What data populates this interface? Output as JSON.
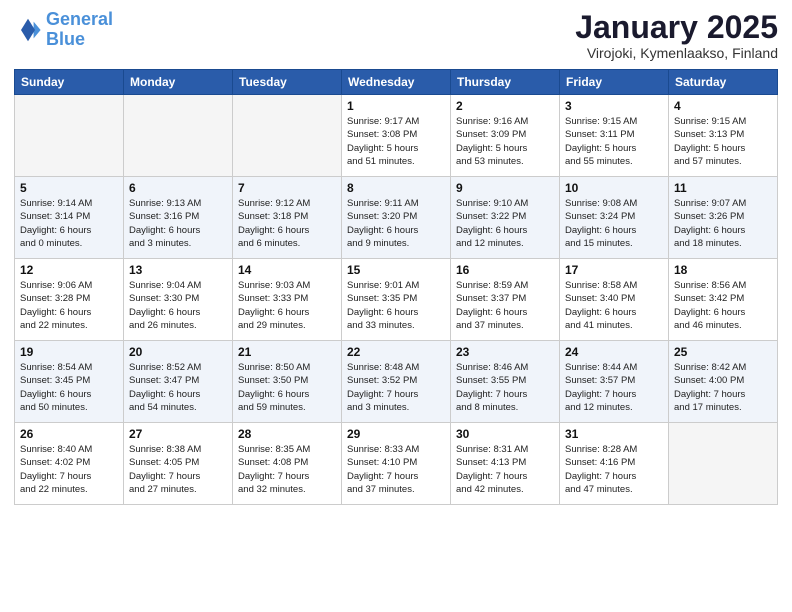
{
  "header": {
    "logo_line1": "General",
    "logo_line2": "Blue",
    "month_title": "January 2025",
    "location": "Virojoki, Kymenlaakso, Finland"
  },
  "weekdays": [
    "Sunday",
    "Monday",
    "Tuesday",
    "Wednesday",
    "Thursday",
    "Friday",
    "Saturday"
  ],
  "weeks": [
    [
      {
        "day": "",
        "info": ""
      },
      {
        "day": "",
        "info": ""
      },
      {
        "day": "",
        "info": ""
      },
      {
        "day": "1",
        "info": "Sunrise: 9:17 AM\nSunset: 3:08 PM\nDaylight: 5 hours\nand 51 minutes."
      },
      {
        "day": "2",
        "info": "Sunrise: 9:16 AM\nSunset: 3:09 PM\nDaylight: 5 hours\nand 53 minutes."
      },
      {
        "day": "3",
        "info": "Sunrise: 9:15 AM\nSunset: 3:11 PM\nDaylight: 5 hours\nand 55 minutes."
      },
      {
        "day": "4",
        "info": "Sunrise: 9:15 AM\nSunset: 3:13 PM\nDaylight: 5 hours\nand 57 minutes."
      }
    ],
    [
      {
        "day": "5",
        "info": "Sunrise: 9:14 AM\nSunset: 3:14 PM\nDaylight: 6 hours\nand 0 minutes."
      },
      {
        "day": "6",
        "info": "Sunrise: 9:13 AM\nSunset: 3:16 PM\nDaylight: 6 hours\nand 3 minutes."
      },
      {
        "day": "7",
        "info": "Sunrise: 9:12 AM\nSunset: 3:18 PM\nDaylight: 6 hours\nand 6 minutes."
      },
      {
        "day": "8",
        "info": "Sunrise: 9:11 AM\nSunset: 3:20 PM\nDaylight: 6 hours\nand 9 minutes."
      },
      {
        "day": "9",
        "info": "Sunrise: 9:10 AM\nSunset: 3:22 PM\nDaylight: 6 hours\nand 12 minutes."
      },
      {
        "day": "10",
        "info": "Sunrise: 9:08 AM\nSunset: 3:24 PM\nDaylight: 6 hours\nand 15 minutes."
      },
      {
        "day": "11",
        "info": "Sunrise: 9:07 AM\nSunset: 3:26 PM\nDaylight: 6 hours\nand 18 minutes."
      }
    ],
    [
      {
        "day": "12",
        "info": "Sunrise: 9:06 AM\nSunset: 3:28 PM\nDaylight: 6 hours\nand 22 minutes."
      },
      {
        "day": "13",
        "info": "Sunrise: 9:04 AM\nSunset: 3:30 PM\nDaylight: 6 hours\nand 26 minutes."
      },
      {
        "day": "14",
        "info": "Sunrise: 9:03 AM\nSunset: 3:33 PM\nDaylight: 6 hours\nand 29 minutes."
      },
      {
        "day": "15",
        "info": "Sunrise: 9:01 AM\nSunset: 3:35 PM\nDaylight: 6 hours\nand 33 minutes."
      },
      {
        "day": "16",
        "info": "Sunrise: 8:59 AM\nSunset: 3:37 PM\nDaylight: 6 hours\nand 37 minutes."
      },
      {
        "day": "17",
        "info": "Sunrise: 8:58 AM\nSunset: 3:40 PM\nDaylight: 6 hours\nand 41 minutes."
      },
      {
        "day": "18",
        "info": "Sunrise: 8:56 AM\nSunset: 3:42 PM\nDaylight: 6 hours\nand 46 minutes."
      }
    ],
    [
      {
        "day": "19",
        "info": "Sunrise: 8:54 AM\nSunset: 3:45 PM\nDaylight: 6 hours\nand 50 minutes."
      },
      {
        "day": "20",
        "info": "Sunrise: 8:52 AM\nSunset: 3:47 PM\nDaylight: 6 hours\nand 54 minutes."
      },
      {
        "day": "21",
        "info": "Sunrise: 8:50 AM\nSunset: 3:50 PM\nDaylight: 6 hours\nand 59 minutes."
      },
      {
        "day": "22",
        "info": "Sunrise: 8:48 AM\nSunset: 3:52 PM\nDaylight: 7 hours\nand 3 minutes."
      },
      {
        "day": "23",
        "info": "Sunrise: 8:46 AM\nSunset: 3:55 PM\nDaylight: 7 hours\nand 8 minutes."
      },
      {
        "day": "24",
        "info": "Sunrise: 8:44 AM\nSunset: 3:57 PM\nDaylight: 7 hours\nand 12 minutes."
      },
      {
        "day": "25",
        "info": "Sunrise: 8:42 AM\nSunset: 4:00 PM\nDaylight: 7 hours\nand 17 minutes."
      }
    ],
    [
      {
        "day": "26",
        "info": "Sunrise: 8:40 AM\nSunset: 4:02 PM\nDaylight: 7 hours\nand 22 minutes."
      },
      {
        "day": "27",
        "info": "Sunrise: 8:38 AM\nSunset: 4:05 PM\nDaylight: 7 hours\nand 27 minutes."
      },
      {
        "day": "28",
        "info": "Sunrise: 8:35 AM\nSunset: 4:08 PM\nDaylight: 7 hours\nand 32 minutes."
      },
      {
        "day": "29",
        "info": "Sunrise: 8:33 AM\nSunset: 4:10 PM\nDaylight: 7 hours\nand 37 minutes."
      },
      {
        "day": "30",
        "info": "Sunrise: 8:31 AM\nSunset: 4:13 PM\nDaylight: 7 hours\nand 42 minutes."
      },
      {
        "day": "31",
        "info": "Sunrise: 8:28 AM\nSunset: 4:16 PM\nDaylight: 7 hours\nand 47 minutes."
      },
      {
        "day": "",
        "info": ""
      }
    ]
  ]
}
